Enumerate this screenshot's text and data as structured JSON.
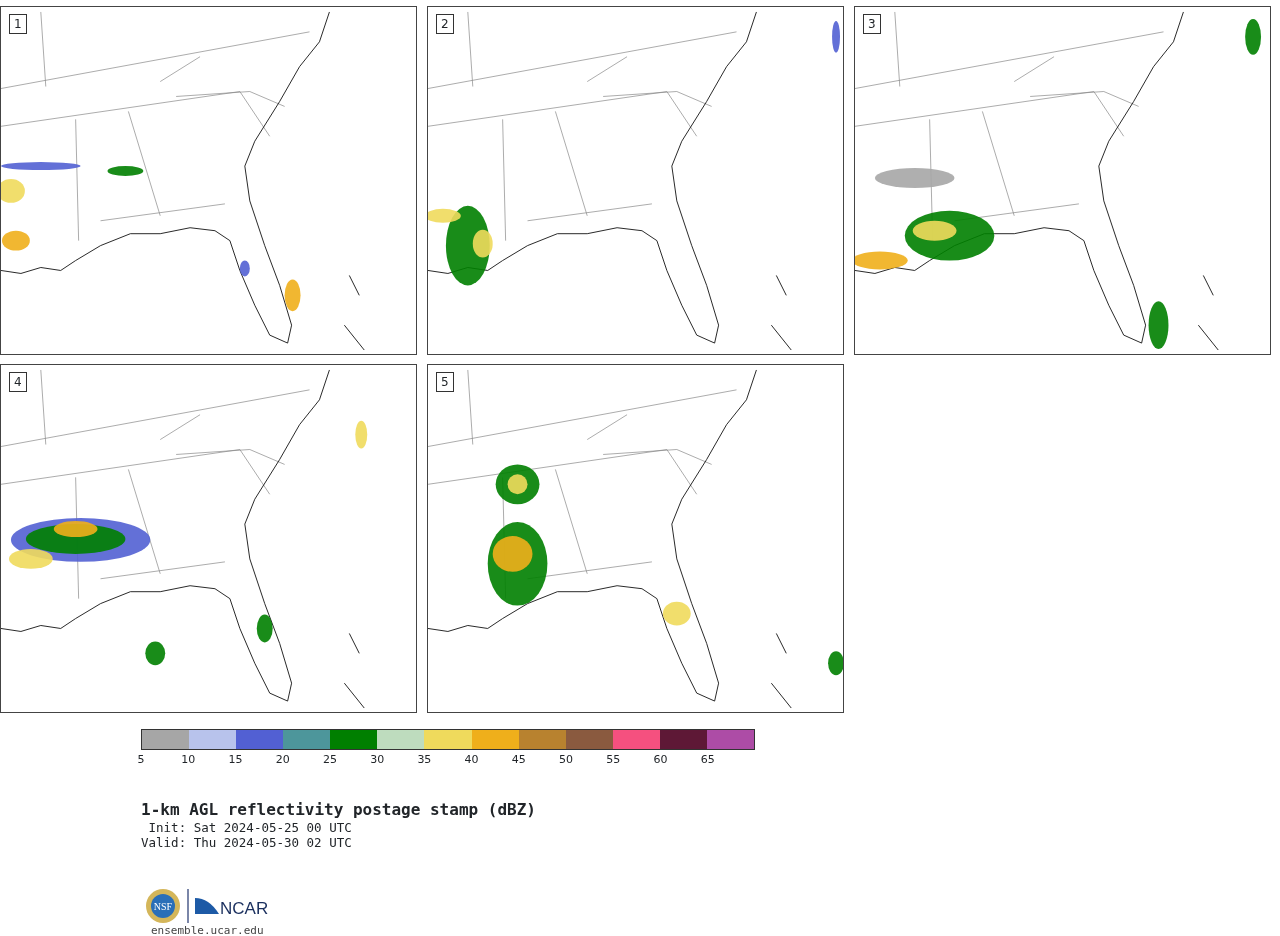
{
  "panels": [
    {
      "label": "1"
    },
    {
      "label": "2"
    },
    {
      "label": "3"
    },
    {
      "label": "4"
    },
    {
      "label": "5"
    }
  ],
  "colorbar": {
    "segments": [
      {
        "color": "#a6a6a6"
      },
      {
        "color": "#b8c3ec"
      },
      {
        "color": "#5260d3"
      },
      {
        "color": "#4d969b"
      },
      {
        "color": "#007f00"
      },
      {
        "color": "#bedcbe"
      },
      {
        "color": "#efda5c"
      },
      {
        "color": "#efaf1b"
      },
      {
        "color": "#b8822f"
      },
      {
        "color": "#8a5a3f"
      },
      {
        "color": "#f5507f"
      },
      {
        "color": "#5e1836"
      },
      {
        "color": "#ad4ca6"
      }
    ],
    "ticks": [
      "5",
      "10",
      "15",
      "20",
      "25",
      "30",
      "35",
      "40",
      "45",
      "50",
      "55",
      "60",
      "65"
    ]
  },
  "title": "1-km AGL reflectivity postage stamp (dBZ)",
  "init": " Init: Sat 2024-05-25 00 UTC",
  "valid": "Valid: Thu 2024-05-30 02 UTC",
  "logo": {
    "nsf": "NSF",
    "ncar": "NCAR"
  },
  "url": "ensemble.ucar.edu"
}
